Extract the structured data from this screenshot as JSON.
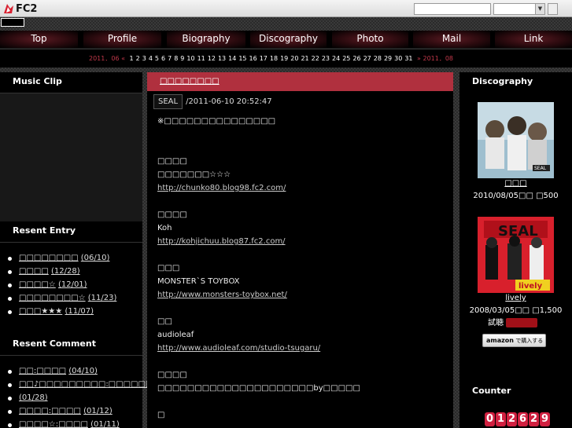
{
  "fc2": {
    "logo_text": "FC2",
    "search_placeholder": "",
    "select_value": ""
  },
  "nav": [
    {
      "label": "Top"
    },
    {
      "label": "Profile"
    },
    {
      "label": "Biography"
    },
    {
      "label": "Discography"
    },
    {
      "label": "Photo"
    },
    {
      "label": "Mail"
    },
    {
      "label": "Link"
    }
  ],
  "calendar": {
    "prev": "2011．06 «",
    "days": [
      "1",
      "2",
      "3",
      "4",
      "5",
      "6",
      "7",
      "8",
      "9",
      "10",
      "11",
      "12",
      "13",
      "14",
      "15",
      "16",
      "17",
      "18",
      "19",
      "20",
      "21",
      "22",
      "23",
      "24",
      "25",
      "26",
      "27",
      "28",
      "29",
      "30",
      "31"
    ],
    "next": "» 2011．08"
  },
  "left": {
    "music_clip_title": "Music Clip",
    "recent_entry_title": "Resent Entry",
    "recent_entries": [
      {
        "title": "□□□□□□□□",
        "date": "(06/10)"
      },
      {
        "title": "□□□□",
        "date": "(12/28)"
      },
      {
        "title": "□□□□☆",
        "date": "(12/01)"
      },
      {
        "title": "□□□□□□□□☆",
        "date": "(11/23)"
      },
      {
        "title": "□□□★★★",
        "date": "(11/07)"
      }
    ],
    "recent_comment_title": "Resent Comment",
    "recent_comments": [
      {
        "text": "□□:□□□□",
        "date": "(04/10)"
      },
      {
        "text": "□□♪□□□□□□□□□:□□□□□□□□",
        "date": "(01/28)"
      },
      {
        "text": "□□□□:□□□□",
        "date": "(01/12)"
      },
      {
        "text": "□□□□☆:□□□□",
        "date": "(01/11)"
      }
    ]
  },
  "entry": {
    "title": "□□□□□□□□",
    "category": "SEAL",
    "datetime": "/2011-06-10 20:52:47",
    "lines": [
      {
        "text": "※□□□□□□□□□□□□□□□",
        "url": false
      },
      {
        "text": "",
        "url": false
      },
      {
        "text": "",
        "url": false
      },
      {
        "text": "□□□□",
        "url": false
      },
      {
        "text": "□□□□□□□☆☆☆",
        "url": false
      },
      {
        "text": "http://chunko80.blog98.fc2.com/",
        "url": true
      },
      {
        "text": "",
        "url": false
      },
      {
        "text": "□□□□",
        "url": false
      },
      {
        "text": "Koh",
        "url": false
      },
      {
        "text": "http://kohjichuu.blog87.fc2.com/",
        "url": true
      },
      {
        "text": "",
        "url": false
      },
      {
        "text": "□□□",
        "url": false
      },
      {
        "text": "MONSTER`S TOYBOX",
        "url": false
      },
      {
        "text": "http://www.monsters-toybox.net/",
        "url": true
      },
      {
        "text": "",
        "url": false
      },
      {
        "text": "□□",
        "url": false
      },
      {
        "text": "audioleaf",
        "url": false
      },
      {
        "text": "http://www.audioleaf.com/studio-tsugaru/",
        "url": true
      },
      {
        "text": "",
        "url": false
      },
      {
        "text": "□□□□",
        "url": false
      },
      {
        "text": "□□□□□□□□□□□□□□□□□□□□□by□□□□□",
        "url": false
      },
      {
        "text": "",
        "url": false
      },
      {
        "text": "□",
        "url": false
      }
    ]
  },
  "right": {
    "discography_title": "Discography",
    "disc1": {
      "title": "□□□",
      "info": "2010/08/05□□ □500",
      "cover_text": "SEAL"
    },
    "disc2": {
      "title": "lively",
      "info": "2008/03/05□□ □1,500",
      "extra": "試聴",
      "cover_text": "SEAL",
      "cover_sub": "lively"
    },
    "amazon_label": "amazon",
    "amazon_suffix": "で購入する",
    "counter_title": "Counter",
    "counter_digits": [
      "0",
      "1",
      "2",
      "6",
      "2",
      "9"
    ]
  },
  "colors": {
    "accent": "#b0303e",
    "calendar_nav": "#c2384a",
    "counter": "#d02040"
  }
}
